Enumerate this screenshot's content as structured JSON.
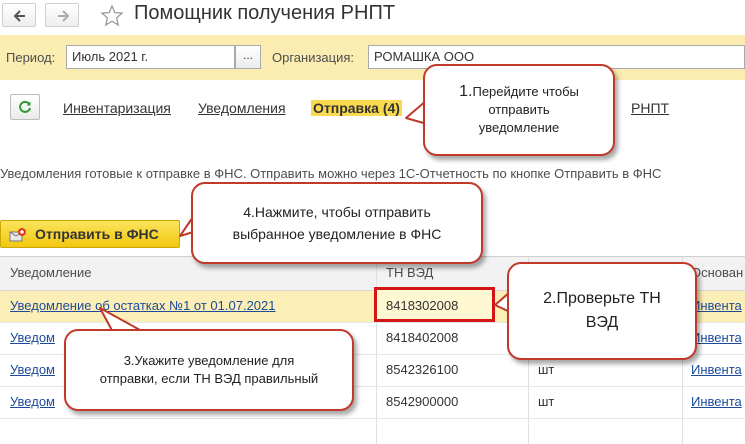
{
  "window": {
    "title": "Помощник получения РНПТ"
  },
  "nav": {
    "back_icon": "arrow-left-icon",
    "forward_icon": "arrow-right-icon",
    "favorite_icon": "star-icon"
  },
  "filters": {
    "period_label": "Период:",
    "period_value": "Июль 2021 г.",
    "period_select": "...",
    "org_label": "Организация:",
    "org_value": "РОМАШКА ООО"
  },
  "tabs": [
    {
      "label": "Инвентаризация",
      "active": false
    },
    {
      "label": "Уведомления",
      "active": false
    },
    {
      "label": "Отправка (4)",
      "active": true
    },
    {
      "label": "РНПТ",
      "active": false
    }
  ],
  "info_text": "Уведомления готовые к отправке в ФНС. Отправить можно через 1С-Отчетность по кнопке Отправить в ФНС",
  "send_button": "Отправить в ФНС",
  "table": {
    "columns": [
      "Уведомление",
      "ТН ВЭД",
      "",
      "Основан"
    ],
    "rows": [
      {
        "notice": "Уведомление об остатках №1 от 01.07.2021",
        "tnved": "8418302008",
        "unit": "",
        "basis": "Инвента",
        "selected": true
      },
      {
        "notice": "Уведом",
        "tnved": "8418402008",
        "unit": "",
        "basis": "Инвента",
        "selected": false
      },
      {
        "notice": "Уведом",
        "tnved": "8542326100",
        "unit": "шт",
        "basis": "Инвента",
        "selected": false
      },
      {
        "notice": "Уведом",
        "tnved": "8542900000",
        "unit": "шт",
        "basis": "Инвента",
        "selected": false
      }
    ]
  },
  "callouts": {
    "c1_number": "1.",
    "c1_line1": "Перейдите чтобы",
    "c1_line2": "отправить",
    "c1_line3": "уведомление",
    "c2_line1": "2.Проверьте ТН",
    "c2_line2": "ВЭД",
    "c3_line1": "3.Укажите уведомление для",
    "c3_line2": "отправки, если ТН ВЭД правильный",
    "c4_line1": "4.Нажмите, чтобы отправить",
    "c4_line2": "выбранное уведомление в ФНС"
  },
  "colors": {
    "filter_bg": "#fbedb2",
    "accent_yellow": "#f8d94f",
    "callout_border": "#c0392b",
    "highlight_red": "#d31515",
    "link": "#1d4b9a"
  }
}
